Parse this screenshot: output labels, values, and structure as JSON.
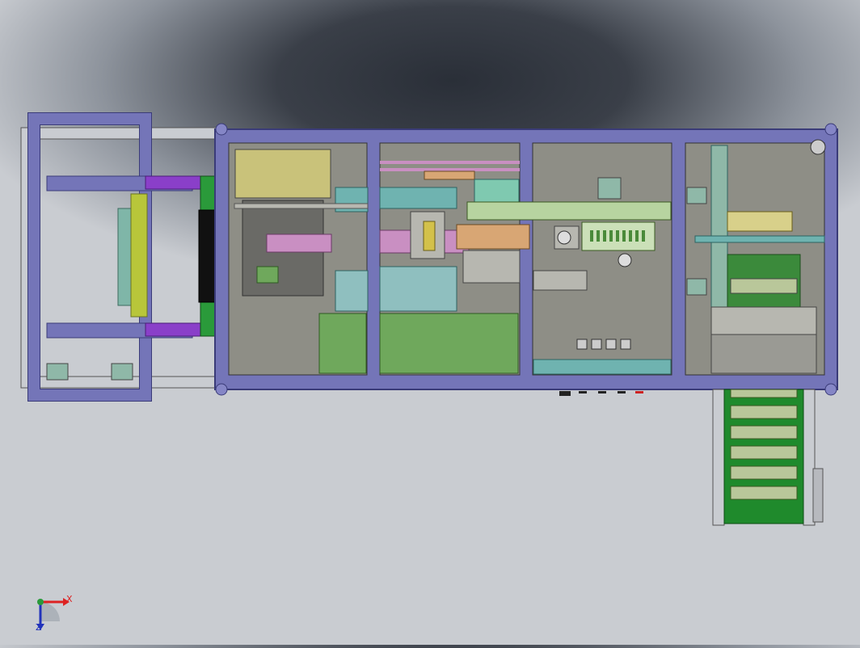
{
  "triad": {
    "x_label": "X",
    "z_label": "Z"
  },
  "colors": {
    "frame": "#7475b8",
    "frame_edge": "#3a3b78",
    "panel_bg": "#8e8e86",
    "green_plate": "#6fa85c",
    "rail": "#c9ccd1",
    "conveyor_green": "#1f8a2c",
    "conveyor_slat": "#b9c79a",
    "pcb_green": "#2a9a3a",
    "yellow_roller": "#b8c63a",
    "purple_bar": "#8a3fc9",
    "teal": "#6fb3b0",
    "pink": "#c98fc2"
  }
}
